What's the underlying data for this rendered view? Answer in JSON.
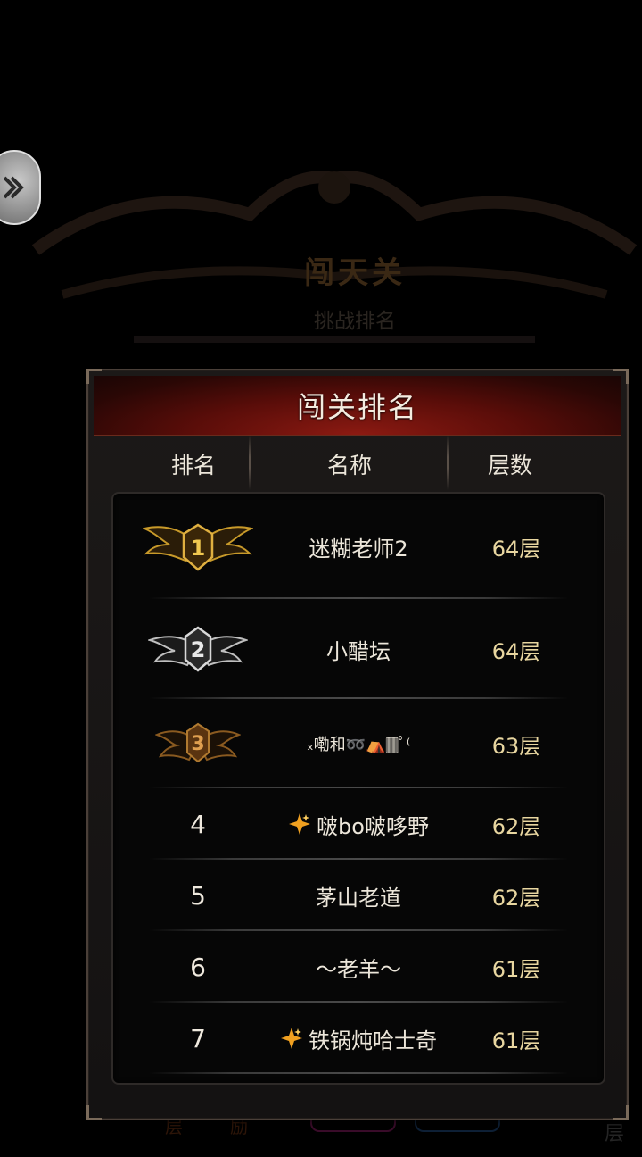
{
  "background": {
    "title": "闯天关",
    "subtitle": "挑战排名",
    "bottom_left_1": "层",
    "bottom_left_2": "励",
    "bottom_right": "层"
  },
  "panel": {
    "title": "闯关排名",
    "columns": {
      "rank": "排名",
      "name": "名称",
      "floor": "层数"
    }
  },
  "ranking": [
    {
      "rank": "1",
      "badge": "gold-wings-badge",
      "name": "迷糊老师2",
      "floor": "64层"
    },
    {
      "rank": "2",
      "badge": "silver-wings-badge",
      "name": "小醋坛",
      "floor": "64层"
    },
    {
      "rank": "3",
      "badge": "bronze-wings-badge",
      "name": "ₓ嘞和➿⛺🀫ﾟ⁽",
      "floor": "63层"
    },
    {
      "rank": "4",
      "icon": "sparkle-icon",
      "name": "啵bo啵哆野",
      "floor": "62层"
    },
    {
      "rank": "5",
      "name": "茅山老道",
      "floor": "62层"
    },
    {
      "rank": "6",
      "name": "～老羊～",
      "floor": "61层"
    },
    {
      "rank": "7",
      "icon": "sparkle-icon",
      "name": "铁锅炖哈士奇",
      "floor": "61层"
    }
  ],
  "colors": {
    "header_red": "#8c1a12",
    "gold": "#c89a2a",
    "silver": "#bfbfbf",
    "bronze": "#8a5a20",
    "floor_text": "#e8d6a0"
  }
}
